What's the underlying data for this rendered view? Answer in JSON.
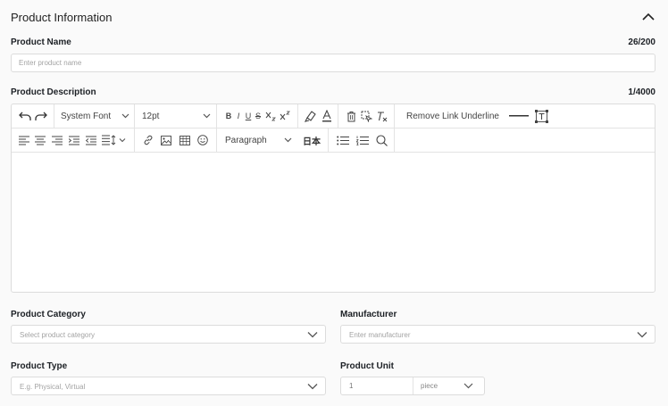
{
  "section": {
    "title": "Product Information"
  },
  "product_name": {
    "label": "Product Name",
    "counter": "26/200",
    "placeholder": "Enter product name"
  },
  "product_description": {
    "label": "Product Description",
    "counter": "1/4000",
    "toolbar": {
      "font_family": "System Font",
      "font_size": "12pt",
      "bold": "B",
      "italic": "I",
      "underline": "U",
      "strikethrough": "S",
      "remove_link_underline": "Remove Link Underline",
      "block_format": "Paragraph",
      "ime": "日本"
    }
  },
  "product_category": {
    "label": "Product Category",
    "placeholder": "Select product category"
  },
  "manufacturer": {
    "label": "Manufacturer",
    "placeholder": "Enter manufacturer"
  },
  "product_type": {
    "label": "Product Type",
    "placeholder": "E.g. Physical, Virtual"
  },
  "product_unit": {
    "label": "Product Unit",
    "quantity_placeholder": "1",
    "unit_value": "piece"
  }
}
